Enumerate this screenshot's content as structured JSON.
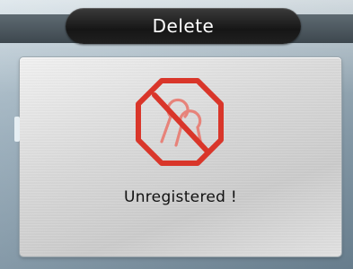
{
  "screen": {
    "title": "Delete",
    "message": "Unregistered !",
    "status_icon": "unregistered-fingerprint-prohibited-icon"
  },
  "colors": {
    "accent_red": "#d9362a",
    "title_text": "#ffffff",
    "message_text": "#111111"
  }
}
